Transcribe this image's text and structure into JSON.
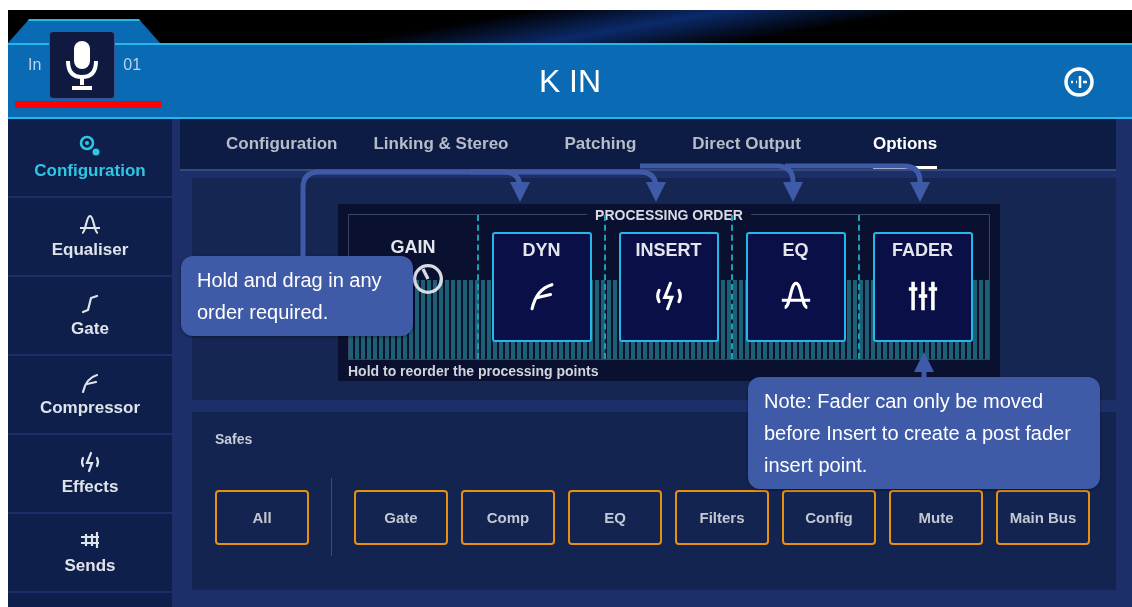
{
  "channel": {
    "prefix": "In",
    "number": "01",
    "name": "K IN"
  },
  "sidebar": {
    "items": [
      {
        "label": "Configuration",
        "selected": true
      },
      {
        "label": "Equaliser",
        "selected": false
      },
      {
        "label": "Gate",
        "selected": false
      },
      {
        "label": "Compressor",
        "selected": false
      },
      {
        "label": "Effects",
        "selected": false
      },
      {
        "label": "Sends",
        "selected": false
      }
    ]
  },
  "tabs": [
    {
      "label": "Configuration",
      "selected": false
    },
    {
      "label": "Linking & Stereo",
      "selected": false
    },
    {
      "label": "Patching",
      "selected": false
    },
    {
      "label": "Direct Output",
      "selected": false
    },
    {
      "label": "Options",
      "selected": true
    }
  ],
  "processing_order": {
    "title": "PROCESSING ORDER",
    "hint": "Hold to reorder the processing points",
    "stages": [
      {
        "label": "GAIN",
        "kind": "fixed"
      },
      {
        "label": "DYN",
        "kind": "movable"
      },
      {
        "label": "INSERT",
        "kind": "movable"
      },
      {
        "label": "EQ",
        "kind": "movable"
      },
      {
        "label": "FADER",
        "kind": "movable"
      }
    ]
  },
  "safes": {
    "title": "Safes",
    "buttons": [
      {
        "label": "All",
        "kind": "all"
      },
      {
        "label": "Gate",
        "kind": "item"
      },
      {
        "label": "Comp",
        "kind": "item"
      },
      {
        "label": "EQ",
        "kind": "item"
      },
      {
        "label": "Filters",
        "kind": "item"
      },
      {
        "label": "Config",
        "kind": "item"
      },
      {
        "label": "Mute",
        "kind": "item"
      },
      {
        "label": "Main Bus",
        "kind": "item"
      }
    ]
  },
  "callouts": [
    {
      "text": "Hold and drag in any order required.",
      "kind": "left"
    },
    {
      "text": "Note: Fader can only be moved before Insert to create a post fader insert point.",
      "kind": "right"
    }
  ]
}
